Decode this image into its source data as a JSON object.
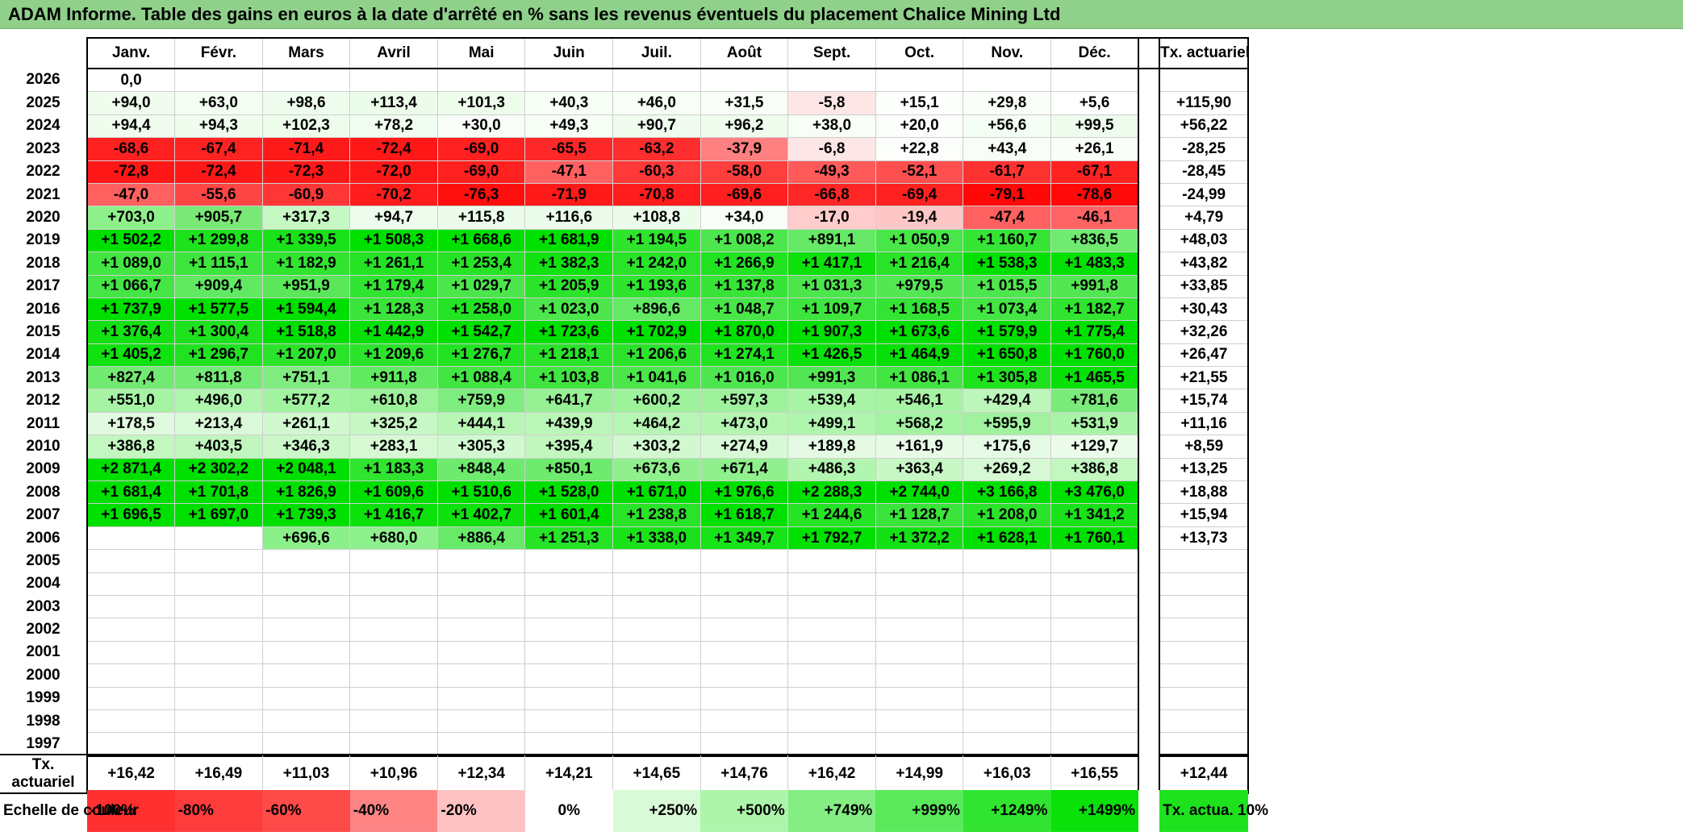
{
  "title": "ADAM Informe. Table des gains en euros à la date d'arrêté en % sans les revenus éventuels du placement Chalice Mining Ltd",
  "months": [
    "Janv.",
    "Févr.",
    "Mars",
    "Avril",
    "Mai",
    "Juin",
    "Juil.",
    "Août",
    "Sept.",
    "Oct.",
    "Nov.",
    "Déc."
  ],
  "ta_header": "Tx. actuariel",
  "rows": [
    {
      "year": "2026",
      "vals": [
        "0,0",
        "",
        "",
        "",
        "",
        "",
        "",
        "",
        "",
        "",
        "",
        ""
      ],
      "colors": [
        "#ffffff",
        "#ffffff",
        "#ffffff",
        "#ffffff",
        "#ffffff",
        "#ffffff",
        "#ffffff",
        "#ffffff",
        "#ffffff",
        "#ffffff",
        "#ffffff",
        "#ffffff"
      ],
      "ta": ""
    },
    {
      "year": "2025",
      "vals": [
        "+94,0",
        "+63,0",
        "+98,6",
        "+113,4",
        "+101,3",
        "+40,3",
        "+46,0",
        "+31,5",
        "-5,8",
        "+15,1",
        "+29,8",
        "+5,6"
      ],
      "colors": [
        "#effcee",
        "#f3fdf2",
        "#eefced",
        "#ecfceb",
        "#eefcec",
        "#f7fef6",
        "#f6fef5",
        "#f8fef7",
        "#fde6e6",
        "#fcfffc",
        "#f9fef8",
        "#fefffe"
      ],
      "ta": "+115,90"
    },
    {
      "year": "2024",
      "vals": [
        "+94,4",
        "+94,3",
        "+102,3",
        "+78,2",
        "+30,0",
        "+49,3",
        "+90,7",
        "+96,2",
        "+38,0",
        "+20,0",
        "+56,6",
        "+99,5"
      ],
      "colors": [
        "#effcee",
        "#effcee",
        "#eefcec",
        "#f1fdf0",
        "#f8fef7",
        "#f6fef5",
        "#effcee",
        "#effcee",
        "#f7fef6",
        "#fbfefa",
        "#f5fef4",
        "#eefced"
      ],
      "ta": "+56,22"
    },
    {
      "year": "2023",
      "vals": [
        "-68,6",
        "-67,4",
        "-71,4",
        "-72,4",
        "-69,0",
        "-65,5",
        "-63,2",
        "-37,9",
        "-6,8",
        "+22,8",
        "+43,4",
        "+26,1"
      ],
      "colors": [
        "#ff2020",
        "#ff2222",
        "#ff1a1a",
        "#ff1818",
        "#ff2020",
        "#ff2828",
        "#ff2e2e",
        "#ff8080",
        "#fde6e6",
        "#fbfefa",
        "#f7fef6",
        "#fafef9"
      ],
      "ta": "-28,25"
    },
    {
      "year": "2022",
      "vals": [
        "-72,8",
        "-72,4",
        "-72,3",
        "-72,0",
        "-69,0",
        "-47,1",
        "-60,3",
        "-58,0",
        "-49,3",
        "-52,1",
        "-61,7",
        "-67,1"
      ],
      "colors": [
        "#ff1717",
        "#ff1818",
        "#ff1818",
        "#ff1919",
        "#ff2020",
        "#ff6060",
        "#ff3838",
        "#ff3e3e",
        "#ff5a5a",
        "#ff5050",
        "#ff3232",
        "#ff2222"
      ],
      "ta": "-28,45"
    },
    {
      "year": "2021",
      "vals": [
        "-47,0",
        "-55,6",
        "-60,9",
        "-70,2",
        "-76,3",
        "-71,9",
        "-70,8",
        "-69,6",
        "-66,8",
        "-69,4",
        "-79,1",
        "-78,6"
      ],
      "colors": [
        "#ff6060",
        "#ff4646",
        "#ff3636",
        "#ff1c1c",
        "#ff0e0e",
        "#ff1919",
        "#ff1c1c",
        "#ff1f1f",
        "#ff2626",
        "#ff2020",
        "#ff0808",
        "#ff0909"
      ],
      "ta": "-24,99"
    },
    {
      "year": "2020",
      "vals": [
        "+703,0",
        "+905,7",
        "+317,3",
        "+94,7",
        "+115,8",
        "+116,6",
        "+108,8",
        "+34,0",
        "-17,0",
        "-19,4",
        "-47,4",
        "-46,1"
      ],
      "colors": [
        "#8ef08a",
        "#7ae876",
        "#c6f8c4",
        "#eefced",
        "#ebfcea",
        "#ebfcea",
        "#ecfceb",
        "#f8fef7",
        "#ffcccc",
        "#ffc6c6",
        "#ff6060",
        "#ff6464"
      ],
      "ta": "+4,79"
    },
    {
      "year": "2019",
      "vals": [
        "+1 502,2",
        "+1 299,8",
        "+1 339,5",
        "+1 508,3",
        "+1 668,6",
        "+1 681,9",
        "+1 194,5",
        "+1 008,2",
        "+891,1",
        "+1 050,9",
        "+1 160,7",
        "+836,5"
      ],
      "colors": [
        "#00e000",
        "#1ee21e",
        "#1ae21a",
        "#00e000",
        "#00e000",
        "#00e000",
        "#2ee42e",
        "#4ee64e",
        "#66e966",
        "#48e648",
        "#36e436",
        "#70ea70"
      ],
      "ta": "+48,03"
    },
    {
      "year": "2018",
      "vals": [
        "+1 089,0",
        "+1 115,1",
        "+1 182,9",
        "+1 261,1",
        "+1 253,4",
        "+1 382,3",
        "+1 242,0",
        "+1 266,9",
        "+1 417,1",
        "+1 216,4",
        "+1 538,3",
        "+1 483,3"
      ],
      "colors": [
        "#42e542",
        "#3ee53e",
        "#30e430",
        "#24e324",
        "#26e326",
        "#12e112",
        "#28e328",
        "#22e322",
        "#0ce10c",
        "#2ae32a",
        "#00e000",
        "#04e004"
      ],
      "ta": "+43,82"
    },
    {
      "year": "2017",
      "vals": [
        "+1 066,7",
        "+909,4",
        "+951,9",
        "+1 179,4",
        "+1 029,7",
        "+1 205,9",
        "+1 193,6",
        "+1 137,8",
        "+1 031,3",
        "+979,5",
        "+1 015,5",
        "+991,8"
      ],
      "colors": [
        "#46e546",
        "#62e962",
        "#5ae85a",
        "#32e432",
        "#4ce64c",
        "#2ce32c",
        "#2ee42e",
        "#38e438",
        "#4ce64c",
        "#54e754",
        "#4ee64e",
        "#52e752"
      ],
      "ta": "+33,85"
    },
    {
      "year": "2016",
      "vals": [
        "+1 737,9",
        "+1 577,5",
        "+1 594,4",
        "+1 128,3",
        "+1 258,0",
        "+1 023,0",
        "+896,6",
        "+1 048,7",
        "+1 109,7",
        "+1 168,5",
        "+1 073,4",
        "+1 182,7"
      ],
      "colors": [
        "#00e000",
        "#00e000",
        "#00e000",
        "#3ae43a",
        "#24e324",
        "#4ce64c",
        "#64e964",
        "#48e648",
        "#3ee53e",
        "#34e434",
        "#44e544",
        "#30e430"
      ],
      "ta": "+30,43"
    },
    {
      "year": "2015",
      "vals": [
        "+1 376,4",
        "+1 300,4",
        "+1 518,8",
        "+1 442,9",
        "+1 542,7",
        "+1 723,6",
        "+1 702,9",
        "+1 870,0",
        "+1 907,3",
        "+1 673,6",
        "+1 579,9",
        "+1 775,4"
      ],
      "colors": [
        "#14e114",
        "#1ee21e",
        "#00e000",
        "#08e008",
        "#00e000",
        "#00e000",
        "#00e000",
        "#00e000",
        "#00e000",
        "#00e000",
        "#00e000",
        "#00e000"
      ],
      "ta": "+32,26"
    },
    {
      "year": "2014",
      "vals": [
        "+1 405,2",
        "+1 296,7",
        "+1 207,0",
        "+1 209,6",
        "+1 276,7",
        "+1 218,1",
        "+1 206,6",
        "+1 274,1",
        "+1 426,5",
        "+1 464,9",
        "+1 650,8",
        "+1 760,0"
      ],
      "colors": [
        "#10e110",
        "#20e220",
        "#2ce32c",
        "#2ce32c",
        "#22e322",
        "#2ae32a",
        "#2ce32c",
        "#22e322",
        "#0ae10a",
        "#06e006",
        "#00e000",
        "#00e000"
      ],
      "ta": "+26,47"
    },
    {
      "year": "2013",
      "vals": [
        "+827,4",
        "+811,8",
        "+751,1",
        "+911,8",
        "+1 088,4",
        "+1 103,8",
        "+1 041,6",
        "+1 016,0",
        "+991,3",
        "+1 086,1",
        "+1 305,8",
        "+1 465,5"
      ],
      "colors": [
        "#72ea72",
        "#74eb74",
        "#80ec80",
        "#62e962",
        "#42e542",
        "#40e540",
        "#4ae64a",
        "#4ee64e",
        "#52e752",
        "#42e542",
        "#1ee21e",
        "#06e006"
      ],
      "ta": "+21,55"
    },
    {
      "year": "2012",
      "vals": [
        "+551,0",
        "+496,0",
        "+577,2",
        "+610,8",
        "+759,9",
        "+641,7",
        "+600,2",
        "+597,3",
        "+539,4",
        "+546,1",
        "+429,4",
        "+781,6"
      ],
      "colors": [
        "#a6f3a4",
        "#b0f5ae",
        "#a2f3a0",
        "#9cf29a",
        "#7eec7e",
        "#96f194",
        "#9ef29c",
        "#9ef29c",
        "#a8f4a6",
        "#a6f3a4",
        "#bcf6ba",
        "#7aeb7a"
      ],
      "ta": "+15,74"
    },
    {
      "year": "2011",
      "vals": [
        "+178,5",
        "+213,4",
        "+261,1",
        "+325,2",
        "+444,1",
        "+439,9",
        "+464,2",
        "+473,0",
        "+499,1",
        "+568,2",
        "+595,9",
        "+531,9"
      ],
      "colors": [
        "#e0fadf",
        "#daf9d8",
        "#d2f8d0",
        "#c6f7c4",
        "#b8f6b6",
        "#baf6b8",
        "#b6f5b4",
        "#b4f5b2",
        "#b0f5ae",
        "#a4f3a2",
        "#a0f29e",
        "#aaf4a8"
      ],
      "ta": "+11,16"
    },
    {
      "year": "2010",
      "vals": [
        "+386,8",
        "+403,5",
        "+346,3",
        "+283,1",
        "+305,3",
        "+395,4",
        "+303,2",
        "+274,9",
        "+189,8",
        "+161,9",
        "+175,6",
        "+129,7"
      ],
      "colors": [
        "#c2f7c0",
        "#c0f6be",
        "#cbf7c9",
        "#d6f9d4",
        "#d2f8d0",
        "#c1f6bf",
        "#d2f8d0",
        "#d8f9d6",
        "#e4fae3",
        "#e8fbe7",
        "#e6fbe5",
        "#ecfceb"
      ],
      "ta": "+8,59"
    },
    {
      "year": "2009",
      "vals": [
        "+2 871,4",
        "+2 302,2",
        "+2 048,1",
        "+1 183,3",
        "+848,4",
        "+850,1",
        "+673,6",
        "+671,4",
        "+486,3",
        "+363,4",
        "+269,2",
        "+386,8"
      ],
      "colors": [
        "#00e000",
        "#00e000",
        "#00e000",
        "#30e430",
        "#6eea6e",
        "#6eea6e",
        "#90f08e",
        "#90f08e",
        "#b2f5b0",
        "#c8f7c6",
        "#d6f9d4",
        "#c2f7c0"
      ],
      "ta": "+13,25"
    },
    {
      "year": "2008",
      "vals": [
        "+1 681,4",
        "+1 701,8",
        "+1 826,9",
        "+1 609,6",
        "+1 510,6",
        "+1 528,0",
        "+1 671,0",
        "+1 976,6",
        "+2 288,3",
        "+2 744,0",
        "+3 166,8",
        "+3 476,0"
      ],
      "colors": [
        "#00e000",
        "#00e000",
        "#00e000",
        "#00e000",
        "#00e000",
        "#00e000",
        "#00e000",
        "#00e000",
        "#00e000",
        "#00e000",
        "#00e000",
        "#00e000"
      ],
      "ta": "+18,88"
    },
    {
      "year": "2007",
      "vals": [
        "+1 696,5",
        "+1 697,0",
        "+1 739,3",
        "+1 416,7",
        "+1 402,7",
        "+1 601,4",
        "+1 238,8",
        "+1 618,7",
        "+1 244,6",
        "+1 128,7",
        "+1 208,0",
        "+1 341,2"
      ],
      "colors": [
        "#00e000",
        "#00e000",
        "#00e000",
        "#0ce10c",
        "#0ee10e",
        "#00e000",
        "#28e328",
        "#00e000",
        "#26e326",
        "#3ae43a",
        "#2ce32c",
        "#1ae21a"
      ],
      "ta": "+15,94"
    },
    {
      "year": "2006",
      "vals": [
        "",
        "",
        "+696,6",
        "+680,0",
        "+886,4",
        "+1 251,3",
        "+1 338,0",
        "+1 349,7",
        "+1 792,7",
        "+1 372,2",
        "+1 628,1",
        "+1 760,1"
      ],
      "colors": [
        "#ffffff",
        "#ffffff",
        "#8cf08a",
        "#8ef08c",
        "#68e968",
        "#26e326",
        "#1ae21a",
        "#18e218",
        "#00e000",
        "#14e114",
        "#00e000",
        "#00e000"
      ],
      "ta": "+13,73"
    },
    {
      "year": "2005",
      "vals": [
        "",
        "",
        "",
        "",
        "",
        "",
        "",
        "",
        "",
        "",
        "",
        ""
      ],
      "colors": [
        "#ffffff",
        "#ffffff",
        "#ffffff",
        "#ffffff",
        "#ffffff",
        "#ffffff",
        "#ffffff",
        "#ffffff",
        "#ffffff",
        "#ffffff",
        "#ffffff",
        "#ffffff"
      ],
      "ta": ""
    },
    {
      "year": "2004",
      "vals": [
        "",
        "",
        "",
        "",
        "",
        "",
        "",
        "",
        "",
        "",
        "",
        ""
      ],
      "colors": [
        "#ffffff",
        "#ffffff",
        "#ffffff",
        "#ffffff",
        "#ffffff",
        "#ffffff",
        "#ffffff",
        "#ffffff",
        "#ffffff",
        "#ffffff",
        "#ffffff",
        "#ffffff"
      ],
      "ta": ""
    },
    {
      "year": "2003",
      "vals": [
        "",
        "",
        "",
        "",
        "",
        "",
        "",
        "",
        "",
        "",
        "",
        ""
      ],
      "colors": [
        "#ffffff",
        "#ffffff",
        "#ffffff",
        "#ffffff",
        "#ffffff",
        "#ffffff",
        "#ffffff",
        "#ffffff",
        "#ffffff",
        "#ffffff",
        "#ffffff",
        "#ffffff"
      ],
      "ta": ""
    },
    {
      "year": "2002",
      "vals": [
        "",
        "",
        "",
        "",
        "",
        "",
        "",
        "",
        "",
        "",
        "",
        ""
      ],
      "colors": [
        "#ffffff",
        "#ffffff",
        "#ffffff",
        "#ffffff",
        "#ffffff",
        "#ffffff",
        "#ffffff",
        "#ffffff",
        "#ffffff",
        "#ffffff",
        "#ffffff",
        "#ffffff"
      ],
      "ta": ""
    },
    {
      "year": "2001",
      "vals": [
        "",
        "",
        "",
        "",
        "",
        "",
        "",
        "",
        "",
        "",
        "",
        ""
      ],
      "colors": [
        "#ffffff",
        "#ffffff",
        "#ffffff",
        "#ffffff",
        "#ffffff",
        "#ffffff",
        "#ffffff",
        "#ffffff",
        "#ffffff",
        "#ffffff",
        "#ffffff",
        "#ffffff"
      ],
      "ta": ""
    },
    {
      "year": "2000",
      "vals": [
        "",
        "",
        "",
        "",
        "",
        "",
        "",
        "",
        "",
        "",
        "",
        ""
      ],
      "colors": [
        "#ffffff",
        "#ffffff",
        "#ffffff",
        "#ffffff",
        "#ffffff",
        "#ffffff",
        "#ffffff",
        "#ffffff",
        "#ffffff",
        "#ffffff",
        "#ffffff",
        "#ffffff"
      ],
      "ta": ""
    },
    {
      "year": "1999",
      "vals": [
        "",
        "",
        "",
        "",
        "",
        "",
        "",
        "",
        "",
        "",
        "",
        ""
      ],
      "colors": [
        "#ffffff",
        "#ffffff",
        "#ffffff",
        "#ffffff",
        "#ffffff",
        "#ffffff",
        "#ffffff",
        "#ffffff",
        "#ffffff",
        "#ffffff",
        "#ffffff",
        "#ffffff"
      ],
      "ta": ""
    },
    {
      "year": "1998",
      "vals": [
        "",
        "",
        "",
        "",
        "",
        "",
        "",
        "",
        "",
        "",
        "",
        ""
      ],
      "colors": [
        "#ffffff",
        "#ffffff",
        "#ffffff",
        "#ffffff",
        "#ffffff",
        "#ffffff",
        "#ffffff",
        "#ffffff",
        "#ffffff",
        "#ffffff",
        "#ffffff",
        "#ffffff"
      ],
      "ta": ""
    },
    {
      "year": "1997",
      "vals": [
        "",
        "",
        "",
        "",
        "",
        "",
        "",
        "",
        "",
        "",
        "",
        ""
      ],
      "colors": [
        "#ffffff",
        "#ffffff",
        "#ffffff",
        "#ffffff",
        "#ffffff",
        "#ffffff",
        "#ffffff",
        "#ffffff",
        "#ffffff",
        "#ffffff",
        "#ffffff",
        "#ffffff"
      ],
      "ta": ""
    }
  ],
  "avg_row": {
    "label": "Tx. actuariel",
    "vals": [
      "+16,42",
      "+16,49",
      "+11,03",
      "+10,96",
      "+12,34",
      "+14,21",
      "+14,65",
      "+14,76",
      "+16,42",
      "+14,99",
      "+16,03",
      "+16,55"
    ],
    "ta": "+12,44"
  },
  "scale": {
    "label": "Echelle de couleur",
    "items": [
      {
        "text": "-100%",
        "color": "#ff3030",
        "align": "left"
      },
      {
        "text": "-80%",
        "color": "#ff3c3c",
        "align": "left"
      },
      {
        "text": "-60%",
        "color": "#ff4a4a",
        "align": "left"
      },
      {
        "text": "-40%",
        "color": "#ff8484",
        "align": "left"
      },
      {
        "text": "-20%",
        "color": "#ffc2c2",
        "align": "left"
      },
      {
        "text": "0%",
        "color": "#ffffff",
        "align": "center"
      },
      {
        "text": "+250%",
        "color": "#d8fad6",
        "align": "right"
      },
      {
        "text": "+500%",
        "color": "#aef5ac",
        "align": "right"
      },
      {
        "text": "+749%",
        "color": "#84ee82",
        "align": "right"
      },
      {
        "text": "+999%",
        "color": "#5ae95a",
        "align": "right"
      },
      {
        "text": "+1249%",
        "color": "#30e430",
        "align": "right"
      },
      {
        "text": "+1499%",
        "color": "#0ae10a",
        "align": "right"
      }
    ],
    "ta_label": "Tx. actua. 10%",
    "ta_color": "#1ee21e"
  }
}
